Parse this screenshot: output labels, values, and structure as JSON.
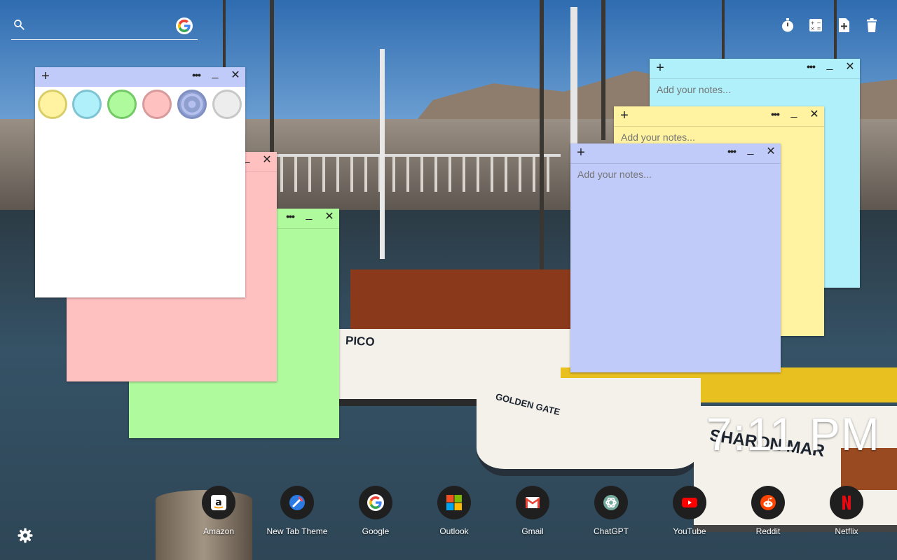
{
  "search": {
    "placeholder": ""
  },
  "top_icons": [
    "timer-icon",
    "calculator-icon",
    "add-note-icon",
    "trash-icon"
  ],
  "notes": [
    {
      "id": "white",
      "color": "#ffffff",
      "placeholder": ""
    },
    {
      "id": "pink",
      "color": "#ffc0c0",
      "placeholder": ""
    },
    {
      "id": "green",
      "color": "#b0fa9e",
      "placeholder": ""
    },
    {
      "id": "cyan",
      "color": "#b0f0fa",
      "placeholder": "Add your notes..."
    },
    {
      "id": "yellow",
      "color": "#fff2a0",
      "placeholder": "Add your notes..."
    },
    {
      "id": "blue",
      "color": "#c0cbfa",
      "placeholder": "Add your notes..."
    }
  ],
  "color_palette": [
    "#fff2a0",
    "#b0f0fa",
    "#b0fa9e",
    "#ffc0c0",
    "#8f9fd0",
    "#ededed"
  ],
  "clock": {
    "time": "7:11 PM"
  },
  "shortcuts": [
    {
      "label": "Amazon",
      "icon": "amazon-icon"
    },
    {
      "label": "New Tab Theme",
      "icon": "new-tab-theme-icon"
    },
    {
      "label": "Google",
      "icon": "google-icon"
    },
    {
      "label": "Outlook",
      "icon": "outlook-icon"
    },
    {
      "label": "Gmail",
      "icon": "gmail-icon"
    },
    {
      "label": "ChatGPT",
      "icon": "chatgpt-icon"
    },
    {
      "label": "YouTube",
      "icon": "youtube-icon"
    },
    {
      "label": "Reddit",
      "icon": "reddit-icon"
    },
    {
      "label": "Netflix",
      "icon": "netflix-icon"
    }
  ],
  "background": {
    "boat_names": [
      "PICO",
      "GOLDEN GATE",
      "SHARON MAR"
    ]
  }
}
